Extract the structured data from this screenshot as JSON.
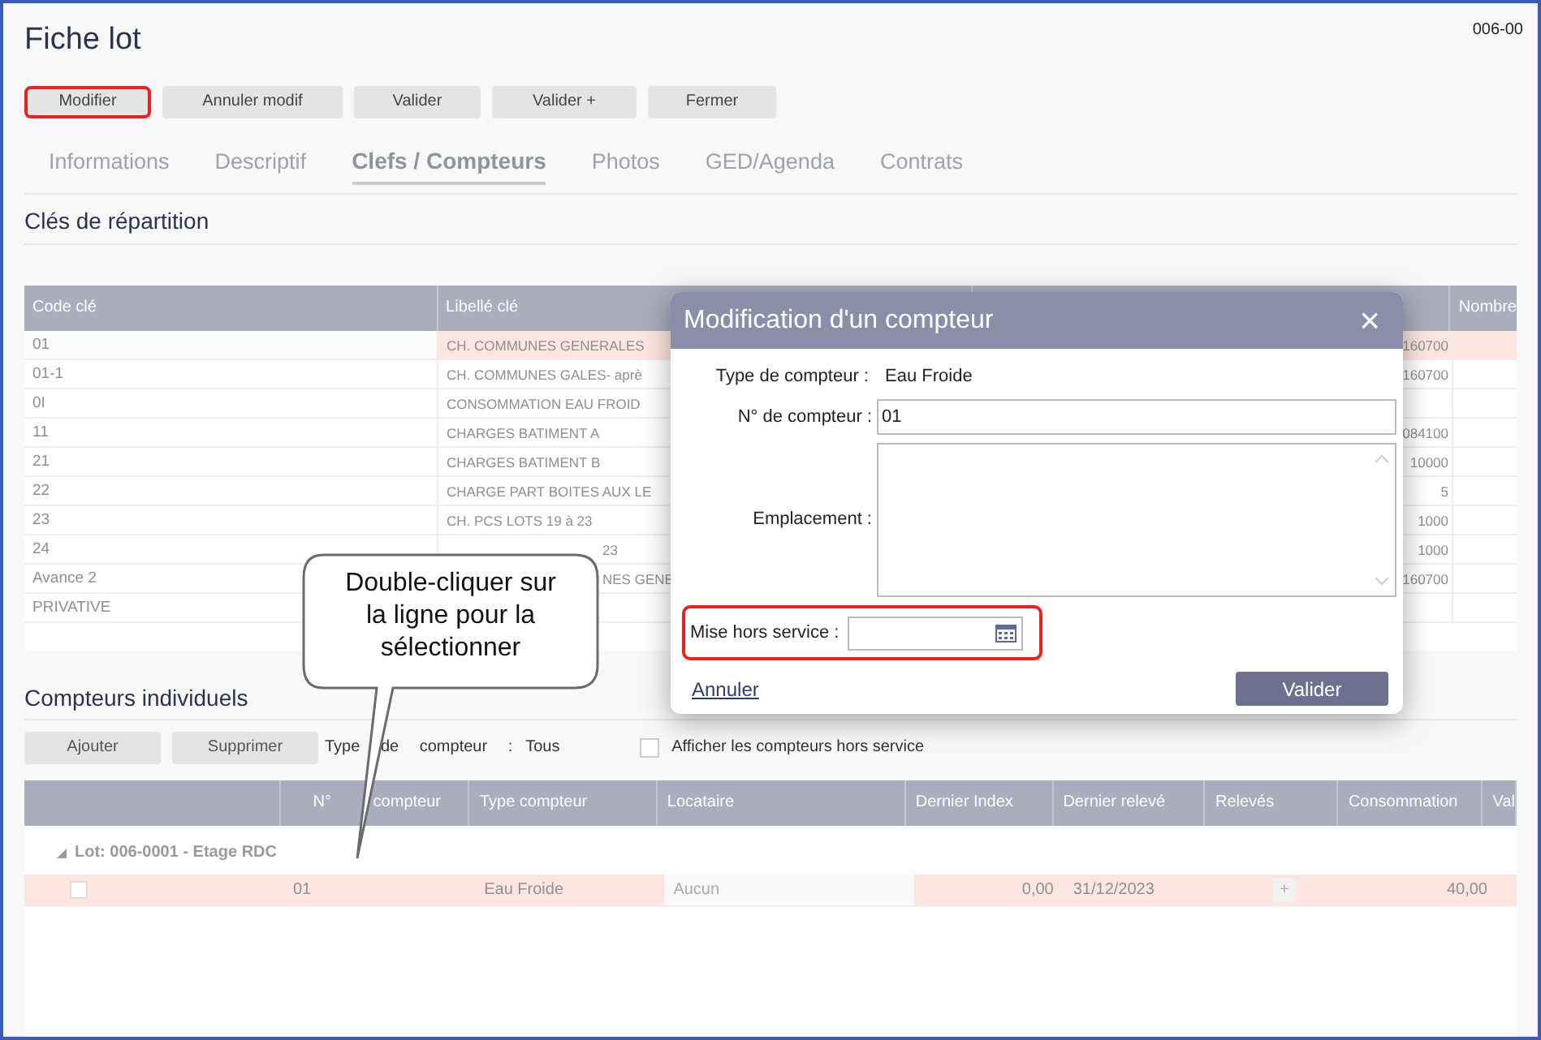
{
  "window": {
    "title": "Fiche lot",
    "ref": "006-00"
  },
  "toolbar": [
    {
      "label": "Modifier",
      "highlighted": true
    },
    {
      "label": "Annuler modif",
      "highlighted": false
    },
    {
      "label": "Valider",
      "highlighted": false
    },
    {
      "label": "Valider +",
      "highlighted": false
    },
    {
      "label": "Fermer",
      "highlighted": false
    }
  ],
  "tabs": [
    {
      "label": "Informations",
      "selected": false
    },
    {
      "label": "Descriptif",
      "selected": false
    },
    {
      "label": "Clefs / Compteurs",
      "selected": true
    },
    {
      "label": "Photos",
      "selected": false
    },
    {
      "label": "GED/Agenda",
      "selected": false
    },
    {
      "label": "Contrats",
      "selected": false
    }
  ],
  "keys_section": {
    "title": "Clés de répartition",
    "columns": [
      "Code clé",
      "Libellé clé",
      "Nombre"
    ],
    "rows": [
      {
        "code": "01",
        "label": "CH. COMMUNES GENERALES",
        "value": "160700",
        "selected": true,
        "partly_hidden": false
      },
      {
        "code": "01-1",
        "label": "CH. COMMUNES GALES- aprè",
        "value": "160700",
        "selected": false,
        "partly_hidden": false
      },
      {
        "code": "0I",
        "label": "CONSOMMATION EAU FROID",
        "value": "",
        "selected": false,
        "partly_hidden": false
      },
      {
        "code": "11",
        "label": "CHARGES BATIMENT A",
        "value": "084100",
        "selected": false,
        "partly_hidden": false
      },
      {
        "code": "21",
        "label": "CHARGES BATIMENT B",
        "value": "10000",
        "selected": false,
        "partly_hidden": false
      },
      {
        "code": "22",
        "label": "CHARGE PART BOITES AUX LE",
        "value": "5",
        "selected": false,
        "partly_hidden": false
      },
      {
        "code": "23",
        "label": "CH. PCS LOTS 19 à 23",
        "value": "1000",
        "selected": false,
        "partly_hidden": false
      },
      {
        "code": "24",
        "label": "23",
        "value": "1000",
        "selected": false,
        "partly_hidden": true
      },
      {
        "code": "Avance 2",
        "label": "NES GENE",
        "value": "160700",
        "selected": false,
        "partly_hidden": true
      },
      {
        "code": "PRIVATIVE",
        "label": "",
        "value": "",
        "selected": false
      }
    ]
  },
  "meters_section": {
    "title": "Compteurs individuels",
    "buttons": [
      "Ajouter",
      "Supprimer"
    ],
    "filter_label": "Type de compteur :",
    "filter_value": "Tous",
    "show_out_of_service": {
      "label": "Afficher les compteurs hors service",
      "checked": false
    },
    "columns": [
      "N° compteur",
      "Type compteur",
      "Locataire",
      "Dernier Index",
      "Dernier relevé",
      "Relevés",
      "Consommation",
      "Val"
    ],
    "group": {
      "label": "Lot: 006-0001 - Etage RDC",
      "expanded": true
    },
    "rows": [
      {
        "checked": false,
        "selected": true,
        "number": "01",
        "type": "Eau Froide",
        "tenant": "Aucun",
        "last_index": "0,00",
        "last_reading": "31/12/2023",
        "readings": "+",
        "consumption": "40,00"
      }
    ]
  },
  "dialog": {
    "title": "Modification d'un compteur",
    "close": "×",
    "type_label": "Type de compteur :",
    "type_value": "Eau Froide",
    "number_label": "N° de compteur :",
    "number_value": "01",
    "location_label": "Emplacement :",
    "out_of_service_label": "Mise hors service :",
    "cancel": "Annuler",
    "submit": "Valider"
  },
  "callout": {
    "text": "Double-cliquer sur la ligne pour la sélectionner"
  }
}
